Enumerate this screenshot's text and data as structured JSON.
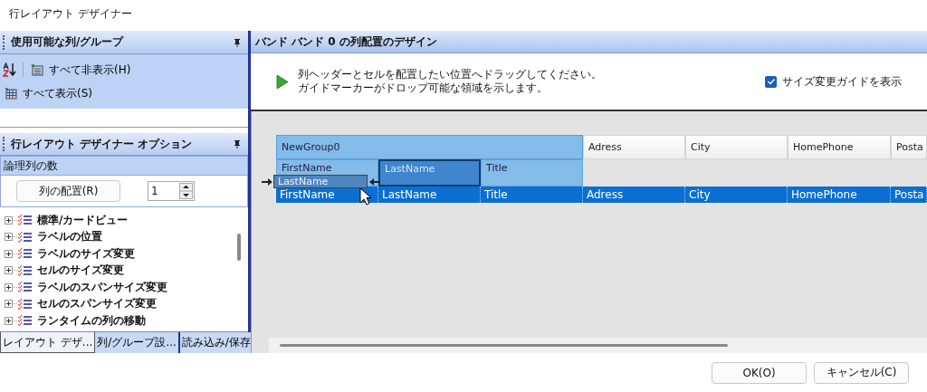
{
  "window": {
    "title": "行レイアウト デザイナー"
  },
  "columns_panel": {
    "title": "使用可能な列/グループ",
    "actions": [
      {
        "kind": "sort"
      },
      {
        "kind": "hide",
        "label": "すべて非表示(H)"
      },
      {
        "kind": "show",
        "label": "すべて表示(S)"
      }
    ]
  },
  "options_panel": {
    "title": "行レイアウト デザイナー オプション",
    "group_label": "論理列の数",
    "arrange_button": "列の配置(R)",
    "spinner_value": "1",
    "tree": [
      {
        "label": "標準/カードビュー",
        "expanded": false
      },
      {
        "label": "ラベルの位置",
        "expanded": false
      },
      {
        "label": "ラベルのサイズ変更",
        "expanded": false
      },
      {
        "label": "セルのサイズ変更",
        "expanded": false
      },
      {
        "label": "ラベルのスパンサイズ変更",
        "expanded": false
      },
      {
        "label": "セルのスパンサイズ変更",
        "expanded": false
      },
      {
        "label": "ランタイムの列の移動",
        "expanded": false
      }
    ],
    "tabs": [
      {
        "label": "レイアウト デザ...",
        "selected": true
      },
      {
        "label": "列/グループ設...",
        "selected": false
      },
      {
        "label": "読み込み/保存",
        "selected": false
      }
    ]
  },
  "design_panel": {
    "title": "バンド バンド 0 の列配置のデザイン",
    "instructions": [
      "列ヘッダーとセルを配置したい位置へドラッグしてください。",
      "ガイドマーカーがドロップ可能な領域を示します。"
    ],
    "resize_guide": {
      "label": "サイズ変更ガイドを表示",
      "checked": true
    },
    "header_row": [
      {
        "kind": "group",
        "label": "NewGroup0"
      },
      {
        "kind": "column",
        "label": "Adress"
      },
      {
        "kind": "column",
        "label": "City"
      },
      {
        "kind": "column",
        "label": "HomePhone"
      },
      {
        "kind": "column",
        "label": "Posta"
      }
    ],
    "group_columns": [
      {
        "label": "FirstName",
        "selected": false
      },
      {
        "label": "LastName",
        "selected": true
      },
      {
        "label": "Title",
        "selected": false
      }
    ],
    "drag_ghost": {
      "label": "LastName"
    },
    "data_row": {
      "selected": true,
      "cells": [
        "FirstName",
        "LastName",
        "Title",
        "Adress",
        "City",
        "HomePhone",
        "Posta"
      ]
    }
  },
  "buttons": [
    {
      "label": "OK(O)"
    },
    {
      "label": "キャンセル(C)"
    }
  ]
}
